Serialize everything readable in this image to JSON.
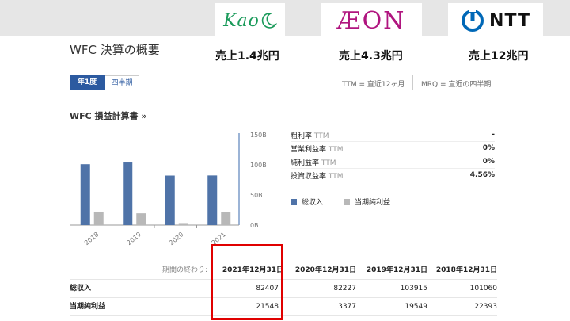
{
  "logos": {
    "kao": "Kao",
    "aeon": "ÆON",
    "ntt": "NTT"
  },
  "revenues": {
    "kao": "売上1.4兆円",
    "aeon": "売上4.3兆円",
    "ntt": "売上12兆円"
  },
  "page": {
    "title": "WFC 決算の概要"
  },
  "tabs": {
    "year": "年1度",
    "quarter": "四半期"
  },
  "notes": {
    "ttm": "TTM = 直近12ヶ月",
    "mrq": "MRQ = 直近の四半期"
  },
  "income": {
    "title": "WFC 損益計算書 »"
  },
  "metrics": [
    {
      "name": "粗利率",
      "ttm": "TTM",
      "value": "-"
    },
    {
      "name": "営業利益率",
      "ttm": "TTM",
      "value": "0%"
    },
    {
      "name": "純利益率",
      "ttm": "TTM",
      "value": "0%"
    },
    {
      "name": "投資収益率",
      "ttm": "TTM",
      "value": "4.56%"
    }
  ],
  "legend": {
    "revenue": "総収入",
    "net_income": "当期純利益"
  },
  "table": {
    "period_label": "期間の終わり:",
    "columns": [
      "2021年12月31日",
      "2020年12月31日",
      "2019年12月31日",
      "2018年12月31日"
    ],
    "rows": [
      {
        "label": "総収入",
        "values": [
          "82407",
          "82227",
          "103915",
          "101060"
        ]
      },
      {
        "label": "当期純利益",
        "values": [
          "21548",
          "3377",
          "19549",
          "22393"
        ]
      }
    ]
  },
  "colors": {
    "revenue": "#4f73a8",
    "net_income": "#b8b8b8",
    "accent": "#2c5aa0",
    "highlight": "#e00000"
  },
  "chart_data": {
    "type": "bar",
    "categories": [
      "2018",
      "2019",
      "2020",
      "2021"
    ],
    "series": [
      {
        "name": "総収入",
        "values": [
          101.06,
          103.915,
          82.227,
          82.407
        ]
      },
      {
        "name": "当期純利益",
        "values": [
          22.393,
          19.549,
          3.377,
          21.548
        ]
      }
    ],
    "yticks": [
      "150B",
      "100B",
      "50B",
      "0B"
    ],
    "ylim": [
      0,
      150
    ],
    "grid": false
  }
}
